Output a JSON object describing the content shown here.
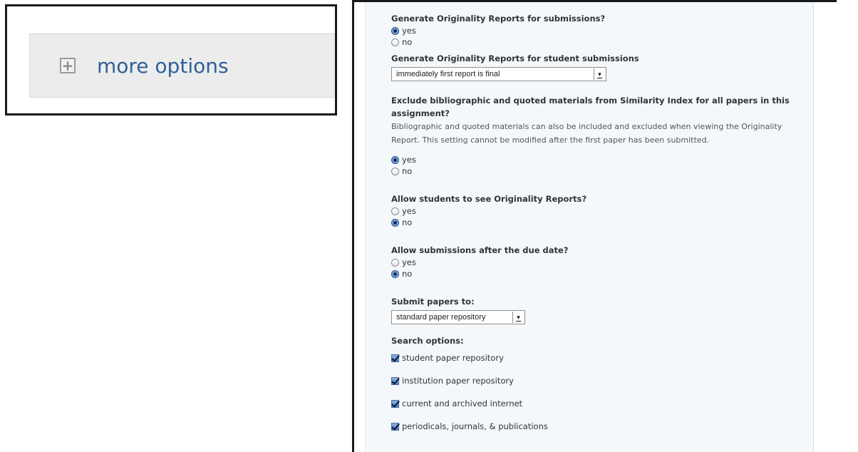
{
  "more_options": {
    "label": "more options",
    "icon": "plus-box-icon"
  },
  "form": {
    "q1": {
      "label": "Generate Originality Reports for submissions?",
      "yes": "yes",
      "no": "no",
      "selected": "yes"
    },
    "q2": {
      "label": "Generate Originality Reports for student submissions",
      "select_value": "immediately first report is final"
    },
    "q3": {
      "label": "Exclude bibliographic and quoted materials from Similarity Index for all papers in this assignment?",
      "description": "Bibliographic and quoted materials can also be included and excluded when viewing the Originality Report. This setting cannot be modified after the first paper has been submitted.",
      "yes": "yes",
      "no": "no",
      "selected": "yes"
    },
    "q4": {
      "label": "Allow students to see Originality Reports?",
      "yes": "yes",
      "no": "no",
      "selected": "no"
    },
    "q5": {
      "label": "Allow submissions after the due date?",
      "yes": "yes",
      "no": "no",
      "selected": "no"
    },
    "q6": {
      "label": "Submit papers to:",
      "select_value": "standard paper repository"
    },
    "search": {
      "label": "Search options:",
      "options": [
        "student paper repository",
        "institution paper repository",
        "current and archived internet",
        "periodicals, journals, & publications"
      ]
    }
  },
  "colors": {
    "link": "#2e5f9a",
    "panel_bg": "#f4f8fb"
  }
}
